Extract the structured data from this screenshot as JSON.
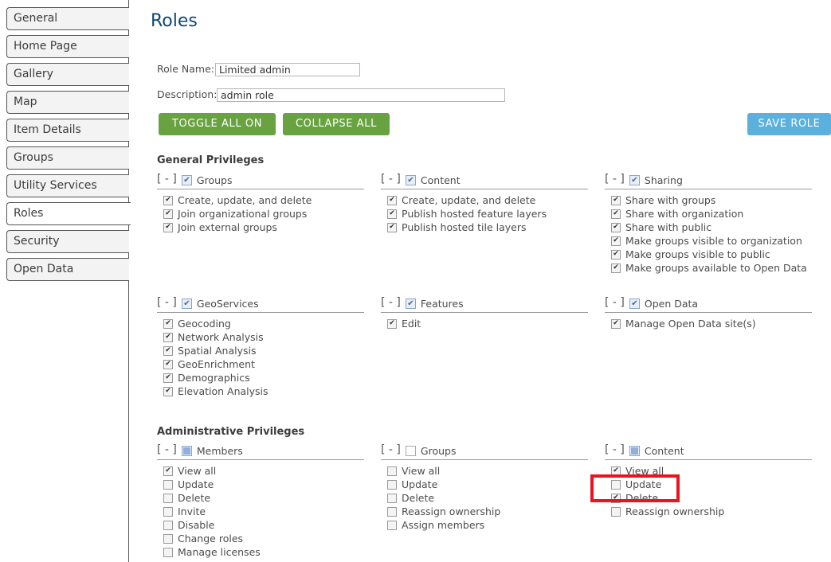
{
  "sidebar": {
    "tabs": [
      "General",
      "Home Page",
      "Gallery",
      "Map",
      "Item Details",
      "Groups",
      "Utility Services",
      "Roles",
      "Security",
      "Open Data"
    ],
    "active": "Roles"
  },
  "page": {
    "title": "Roles"
  },
  "form": {
    "role_name_label": "Role Name:",
    "role_name_value": "Limited admin",
    "description_label": "Description:",
    "description_value": "admin role"
  },
  "buttons": {
    "toggle_all": "TOGGLE ALL ON",
    "collapse_all": "COLLAPSE ALL",
    "save_role": "SAVE ROLE"
  },
  "colors": {
    "green": "#69a240",
    "blue": "#5bb0dd",
    "title": "#0c4a6e",
    "highlight": "#e8141f"
  },
  "sections": [
    {
      "title": "General Privileges",
      "rows": [
        [
          {
            "toggle": "[ - ]",
            "name": "Groups",
            "state": "checked",
            "items": [
              {
                "label": "Create, update, and delete",
                "checked": true
              },
              {
                "label": "Join organizational groups",
                "checked": true
              },
              {
                "label": "Join external groups",
                "checked": true
              }
            ]
          },
          {
            "toggle": "[ - ]",
            "name": "Content",
            "state": "checked",
            "items": [
              {
                "label": "Create, update, and delete",
                "checked": true
              },
              {
                "label": "Publish hosted feature layers",
                "checked": true
              },
              {
                "label": "Publish hosted tile layers",
                "checked": true
              }
            ]
          },
          {
            "toggle": "[ - ]",
            "name": "Sharing",
            "state": "checked",
            "items": [
              {
                "label": "Share with groups",
                "checked": true
              },
              {
                "label": "Share with organization",
                "checked": true
              },
              {
                "label": "Share with public",
                "checked": true
              },
              {
                "label": "Make groups visible to organization",
                "checked": true
              },
              {
                "label": "Make groups visible to public",
                "checked": true
              },
              {
                "label": "Make groups available to Open Data",
                "checked": true
              }
            ]
          }
        ],
        [
          {
            "toggle": "[ - ]",
            "name": "GeoServices",
            "state": "checked",
            "items": [
              {
                "label": "Geocoding",
                "checked": true
              },
              {
                "label": "Network Analysis",
                "checked": true
              },
              {
                "label": "Spatial Analysis",
                "checked": true
              },
              {
                "label": "GeoEnrichment",
                "checked": true
              },
              {
                "label": "Demographics",
                "checked": true
              },
              {
                "label": "Elevation Analysis",
                "checked": true
              }
            ]
          },
          {
            "toggle": "[ - ]",
            "name": "Features",
            "state": "checked",
            "items": [
              {
                "label": "Edit",
                "checked": true
              }
            ]
          },
          {
            "toggle": "[ - ]",
            "name": "Open Data",
            "state": "checked",
            "items": [
              {
                "label": "Manage Open Data site(s)",
                "checked": true
              }
            ]
          }
        ]
      ]
    },
    {
      "title": "Administrative Privileges",
      "rows": [
        [
          {
            "toggle": "[ - ]",
            "name": "Members",
            "state": "partial",
            "items": [
              {
                "label": "View all",
                "checked": true
              },
              {
                "label": "Update",
                "checked": false
              },
              {
                "label": "Delete",
                "checked": false
              },
              {
                "label": "Invite",
                "checked": false
              },
              {
                "label": "Disable",
                "checked": false
              },
              {
                "label": "Change roles",
                "checked": false
              },
              {
                "label": "Manage licenses",
                "checked": false
              }
            ]
          },
          {
            "toggle": "[ - ]",
            "name": "Groups",
            "state": "unchecked",
            "items": [
              {
                "label": "View all",
                "checked": false
              },
              {
                "label": "Update",
                "checked": false
              },
              {
                "label": "Delete",
                "checked": false
              },
              {
                "label": "Reassign ownership",
                "checked": false
              },
              {
                "label": "Assign members",
                "checked": false
              }
            ]
          },
          {
            "toggle": "[ - ]",
            "name": "Content",
            "state": "partial",
            "items": [
              {
                "label": "View all",
                "checked": true
              },
              {
                "label": "Update",
                "checked": false
              },
              {
                "label": "Delete",
                "checked": true
              },
              {
                "label": "Reassign ownership",
                "checked": false
              }
            ]
          }
        ]
      ]
    }
  ]
}
